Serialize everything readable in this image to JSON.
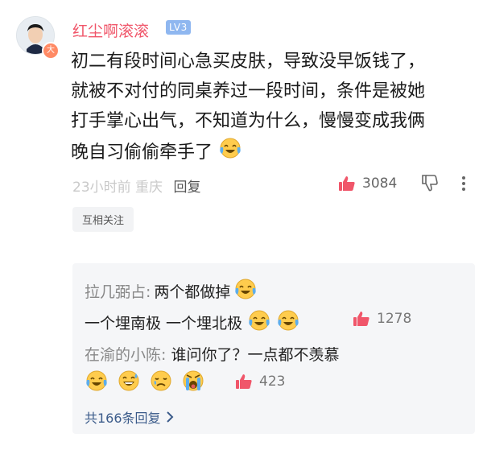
{
  "comment": {
    "username": "红尘啊滚滚",
    "level": "LV3",
    "avatar_badge": "大",
    "text_lines": [
      "初二有段时间心急买皮肤，导致没早饭钱了，",
      "就被不对付的同桌养过一段时间，条件是被她",
      "打手掌心出气，不知道为什么，慢慢变成我俩",
      "晚自习偷偷牵手了"
    ],
    "time_location": "23小时前 重庆",
    "reply_label": "回复",
    "like_count": "3084",
    "follow_tag": "互相关注"
  },
  "replies": [
    {
      "author": "拉几弼占:",
      "text": " 两个都做掉"
    },
    {
      "author": "",
      "text": "一个埋南极 一个埋北极",
      "like_count": "1278"
    },
    {
      "author": "在渝的小陈:",
      "text": " 谁问你了？一点都不羡慕",
      "like_count": "423"
    }
  ],
  "total_replies": "共166条回复",
  "icons": {
    "like": "thumbs-up-icon",
    "dislike": "thumbs-down-icon",
    "more": "more-vertical-icon",
    "chevron": "chevron-right-icon",
    "emoji_cry_laugh": "tears-of-joy-icon",
    "emoji_laugh": "grinning-sweat-icon",
    "emoji_sad": "sad-face-icon",
    "emoji_wail": "wailing-face-icon"
  },
  "colors": {
    "username": "#f0566a",
    "like": "#f0566a",
    "link": "#3b5b8a"
  }
}
